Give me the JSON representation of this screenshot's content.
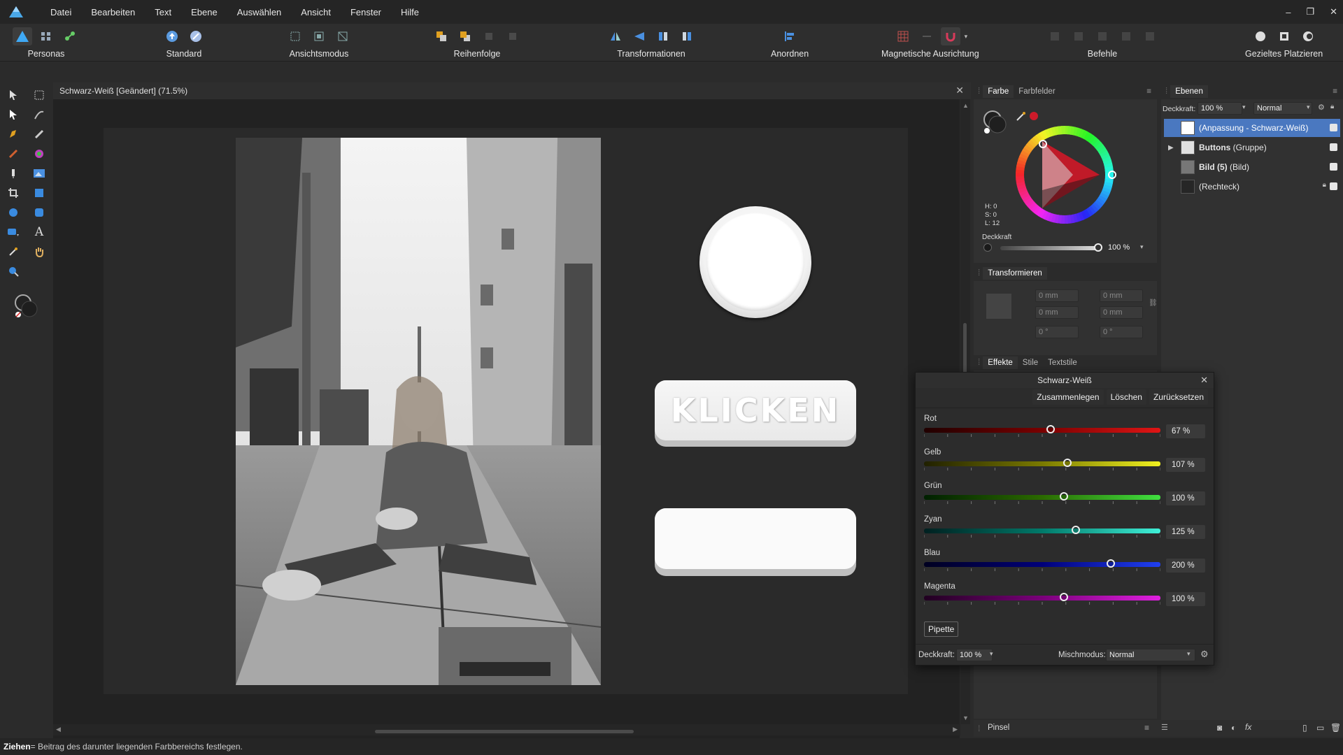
{
  "menubar": {
    "items": [
      "Datei",
      "Bearbeiten",
      "Text",
      "Ebene",
      "Auswählen",
      "Ansicht",
      "Fenster",
      "Hilfe"
    ],
    "window_controls": [
      "–",
      "❐",
      "✕"
    ]
  },
  "toolbar": {
    "personas": "Personas",
    "standard": "Standard",
    "ansichtsmodus": "Ansichtsmodus",
    "reihenfolge": "Reihenfolge",
    "transformationen": "Transformationen",
    "anordnen": "Anordnen",
    "magnetisch": "Magnetische Ausrichtung",
    "befehle": "Befehle",
    "platzieren": "Gezieltes Platzieren"
  },
  "document": {
    "tab_title": "Schwarz-Weiß [Geändert] (71.5%)",
    "button_text": "KLICKEN"
  },
  "color_panel": {
    "tabs": [
      "Farbe",
      "Farbfelder"
    ],
    "hsl": [
      "H: 0",
      "S: 0",
      "L: 12"
    ],
    "opacity_label": "Deckkraft",
    "opacity_value": "100 %",
    "opacity_fraction": 1.0,
    "accent_color": "#cc1b2a"
  },
  "transform_panel": {
    "title": "Transformieren",
    "fields": [
      "0 mm",
      "0 mm",
      "0 mm",
      "0 mm",
      "0 °",
      "0 °"
    ]
  },
  "effects_tabs": [
    "Effekte",
    "Stile",
    "Textstile"
  ],
  "layers_panel": {
    "title": "Ebenen",
    "opacity_label": "Deckkraft:",
    "opacity_value": "100 %",
    "blend_mode": "Normal",
    "rows": [
      {
        "label": "(Anpassung - Schwarz-Weiß)",
        "selected": true
      },
      {
        "label": "Buttons",
        "suffix": "(Gruppe)",
        "selected": false
      },
      {
        "label": "Bild (5)",
        "suffix": "(Bild)",
        "selected": false
      },
      {
        "label": "(Rechteck)",
        "selected": false
      }
    ]
  },
  "sw_dialog": {
    "title": "Schwarz-Weiß",
    "buttons": [
      "Zusammenlegen",
      "Löschen",
      "Zurücksetzen"
    ],
    "sliders": [
      {
        "label": "Rot",
        "value": "67 %",
        "fraction": 0.535,
        "gradient": "linear-gradient(90deg,#200000,#7a0000,#e01515)"
      },
      {
        "label": "Gelb",
        "value": "107 %",
        "fraction": 0.607,
        "gradient": "linear-gradient(90deg,#202000,#7a7a00,#f0f020)"
      },
      {
        "label": "Grün",
        "value": "100 %",
        "fraction": 0.593,
        "gradient": "linear-gradient(90deg,#002000,#2b6a00,#40e040)"
      },
      {
        "label": "Zyan",
        "value": "125 %",
        "fraction": 0.643,
        "gradient": "linear-gradient(90deg,#002020,#007a6a,#40f0d8)"
      },
      {
        "label": "Blau",
        "value": "200 %",
        "fraction": 0.79,
        "gradient": "linear-gradient(90deg,#000020,#00007a,#2040f0)"
      },
      {
        "label": "Magenta",
        "value": "100 %",
        "fraction": 0.593,
        "gradient": "linear-gradient(90deg,#200020,#7a007a,#e020e0)"
      }
    ],
    "pipette": "Pipette",
    "opacity_label": "Deckkraft:",
    "opacity_value": "100 %",
    "blend_label": "Mischmodus:",
    "blend_value": "Normal"
  },
  "bottom_panel": {
    "label": "Pinsel"
  },
  "statusbar": {
    "bold": "Ziehen",
    "text": " = Beitrag des darunter liegenden Farbbereichs festlegen."
  }
}
